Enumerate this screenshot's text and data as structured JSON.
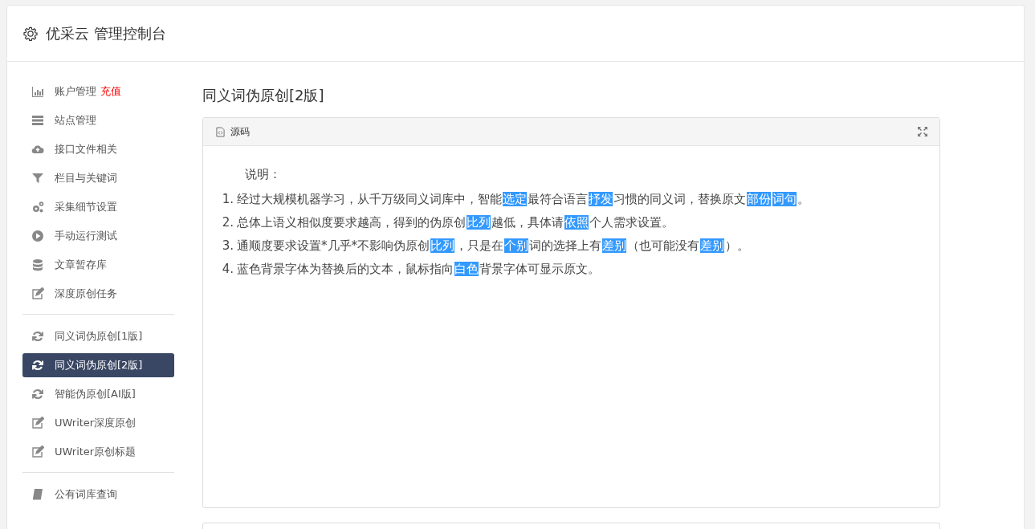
{
  "header": {
    "title": "优采云 管理控制台"
  },
  "sidebar": {
    "groups": [
      {
        "items": [
          {
            "label": "账户管理",
            "badge": "充值",
            "selected": false
          },
          {
            "label": "站点管理",
            "selected": false
          },
          {
            "label": "接口文件相关",
            "selected": false
          },
          {
            "label": "栏目与关键词",
            "selected": false
          },
          {
            "label": "采集细节设置",
            "selected": false
          },
          {
            "label": "手动运行测试",
            "selected": false
          },
          {
            "label": "文章暂存库",
            "selected": false
          },
          {
            "label": "深度原创任务",
            "selected": false
          }
        ]
      },
      {
        "items": [
          {
            "label": "同义词伪原创[1版]",
            "selected": false
          },
          {
            "label": "同义词伪原创[2版]",
            "selected": true
          },
          {
            "label": "智能伪原创[AI版]",
            "selected": false
          },
          {
            "label": "UWriter深度原创",
            "selected": false
          },
          {
            "label": "UWriter原创标题",
            "selected": false
          }
        ]
      },
      {
        "items": [
          {
            "label": "公有词库查询",
            "selected": false
          }
        ]
      }
    ]
  },
  "main": {
    "title": "同义词伪原创[2版]",
    "editor": {
      "toolbar_label": "源码",
      "heading": "说明：",
      "lines": [
        {
          "number": "1.",
          "segments": [
            {
              "text": "经过大规模机器学习，从千万级同义词库中，智能",
              "replaced": false
            },
            {
              "text": "选定",
              "replaced": true
            },
            {
              "text": "最符合语言",
              "replaced": false
            },
            {
              "text": "抒发",
              "replaced": true
            },
            {
              "text": "习惯的同义词，替换原文",
              "replaced": false
            },
            {
              "text": "部份",
              "replaced": true
            },
            {
              "text": "词句",
              "replaced": true
            },
            {
              "text": "。",
              "replaced": false
            }
          ]
        },
        {
          "number": "2.",
          "segments": [
            {
              "text": "总体上语义相似度要求越高，得到的伪原创",
              "replaced": false
            },
            {
              "text": "比列",
              "replaced": true
            },
            {
              "text": "越低，具体请",
              "replaced": false
            },
            {
              "text": "依照",
              "replaced": true
            },
            {
              "text": "个人需求设置。",
              "replaced": false
            }
          ]
        },
        {
          "number": "3.",
          "segments": [
            {
              "text": "通顺度要求设置*几乎*不影响伪原创",
              "replaced": false
            },
            {
              "text": "比列",
              "replaced": true
            },
            {
              "text": "，只是在",
              "replaced": false
            },
            {
              "text": "个别",
              "replaced": true
            },
            {
              "text": "词的选择上有",
              "replaced": false
            },
            {
              "text": "差别",
              "replaced": true
            },
            {
              "text": "（也可能没有",
              "replaced": false
            },
            {
              "text": "差别",
              "replaced": true
            },
            {
              "text": "）。",
              "replaced": false
            }
          ]
        },
        {
          "number": "4.",
          "segments": [
            {
              "text": "蓝色背景字体为替换后的文本，鼠标指向",
              "replaced": false
            },
            {
              "text": "白色",
              "replaced": true
            },
            {
              "text": "背景字体可显示原文。",
              "replaced": false
            }
          ]
        }
      ]
    }
  }
}
